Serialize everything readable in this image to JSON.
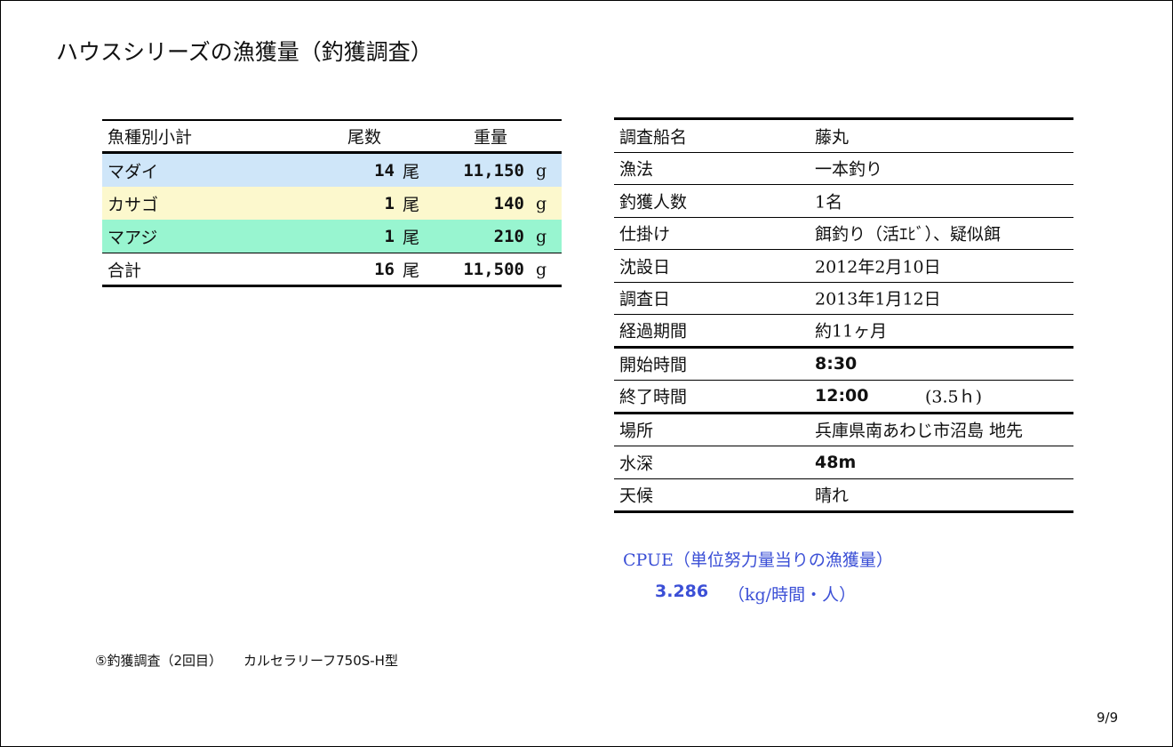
{
  "title": "ハウスシリーズの漁獲量（釣獲調査）",
  "catch_table": {
    "headers": {
      "species": "魚種別小計",
      "count": "尾数",
      "weight": "重量"
    },
    "rows": [
      {
        "name": "マダイ",
        "count": "14",
        "count_unit": "尾",
        "weight": "11,150",
        "weight_unit": "g",
        "bg": "#cfe6f9"
      },
      {
        "name": "カサゴ",
        "count": "1",
        "count_unit": "尾",
        "weight": "140",
        "weight_unit": "g",
        "bg": "#fcf8cd"
      },
      {
        "name": "マアジ",
        "count": "1",
        "count_unit": "尾",
        "weight": "210",
        "weight_unit": "g",
        "bg": "#98f5d0"
      }
    ],
    "total": {
      "name": "合計",
      "count": "16",
      "count_unit": "尾",
      "weight": "11,500",
      "weight_unit": "g"
    }
  },
  "info_table": [
    {
      "label": "調査船名",
      "value": "藤丸"
    },
    {
      "label": "漁法",
      "value": "一本釣り"
    },
    {
      "label": "釣獲人数",
      "value": "1名"
    },
    {
      "label": "仕掛け",
      "value": "餌釣り（活ｴﾋﾞ）、疑似餌"
    },
    {
      "label": "沈設日",
      "value": "2012年2月10日"
    },
    {
      "label": "調査日",
      "value": "2013年1月12日"
    },
    {
      "label": "経過期間",
      "value": "約11ヶ月"
    },
    {
      "label": "開始時間",
      "value": "8:30"
    },
    {
      "label": "終了時間",
      "value": "12:00",
      "note": "(3.5ｈ)"
    },
    {
      "label": "場所",
      "value": "兵庫県南あわじ市沼島 地先"
    },
    {
      "label": "水深",
      "value": "48m"
    },
    {
      "label": "天候",
      "value": "晴れ"
    }
  ],
  "cpue": {
    "label": "CPUE（単位努力量当りの漁獲量）",
    "value": "3.286",
    "unit": "（kg/時間・人）",
    "color": "#3b4fd6"
  },
  "caption": {
    "survey": "⑤釣獲調査（2回目）",
    "model": "カルセラリーフ750S-H型"
  },
  "page_number": "9/9"
}
